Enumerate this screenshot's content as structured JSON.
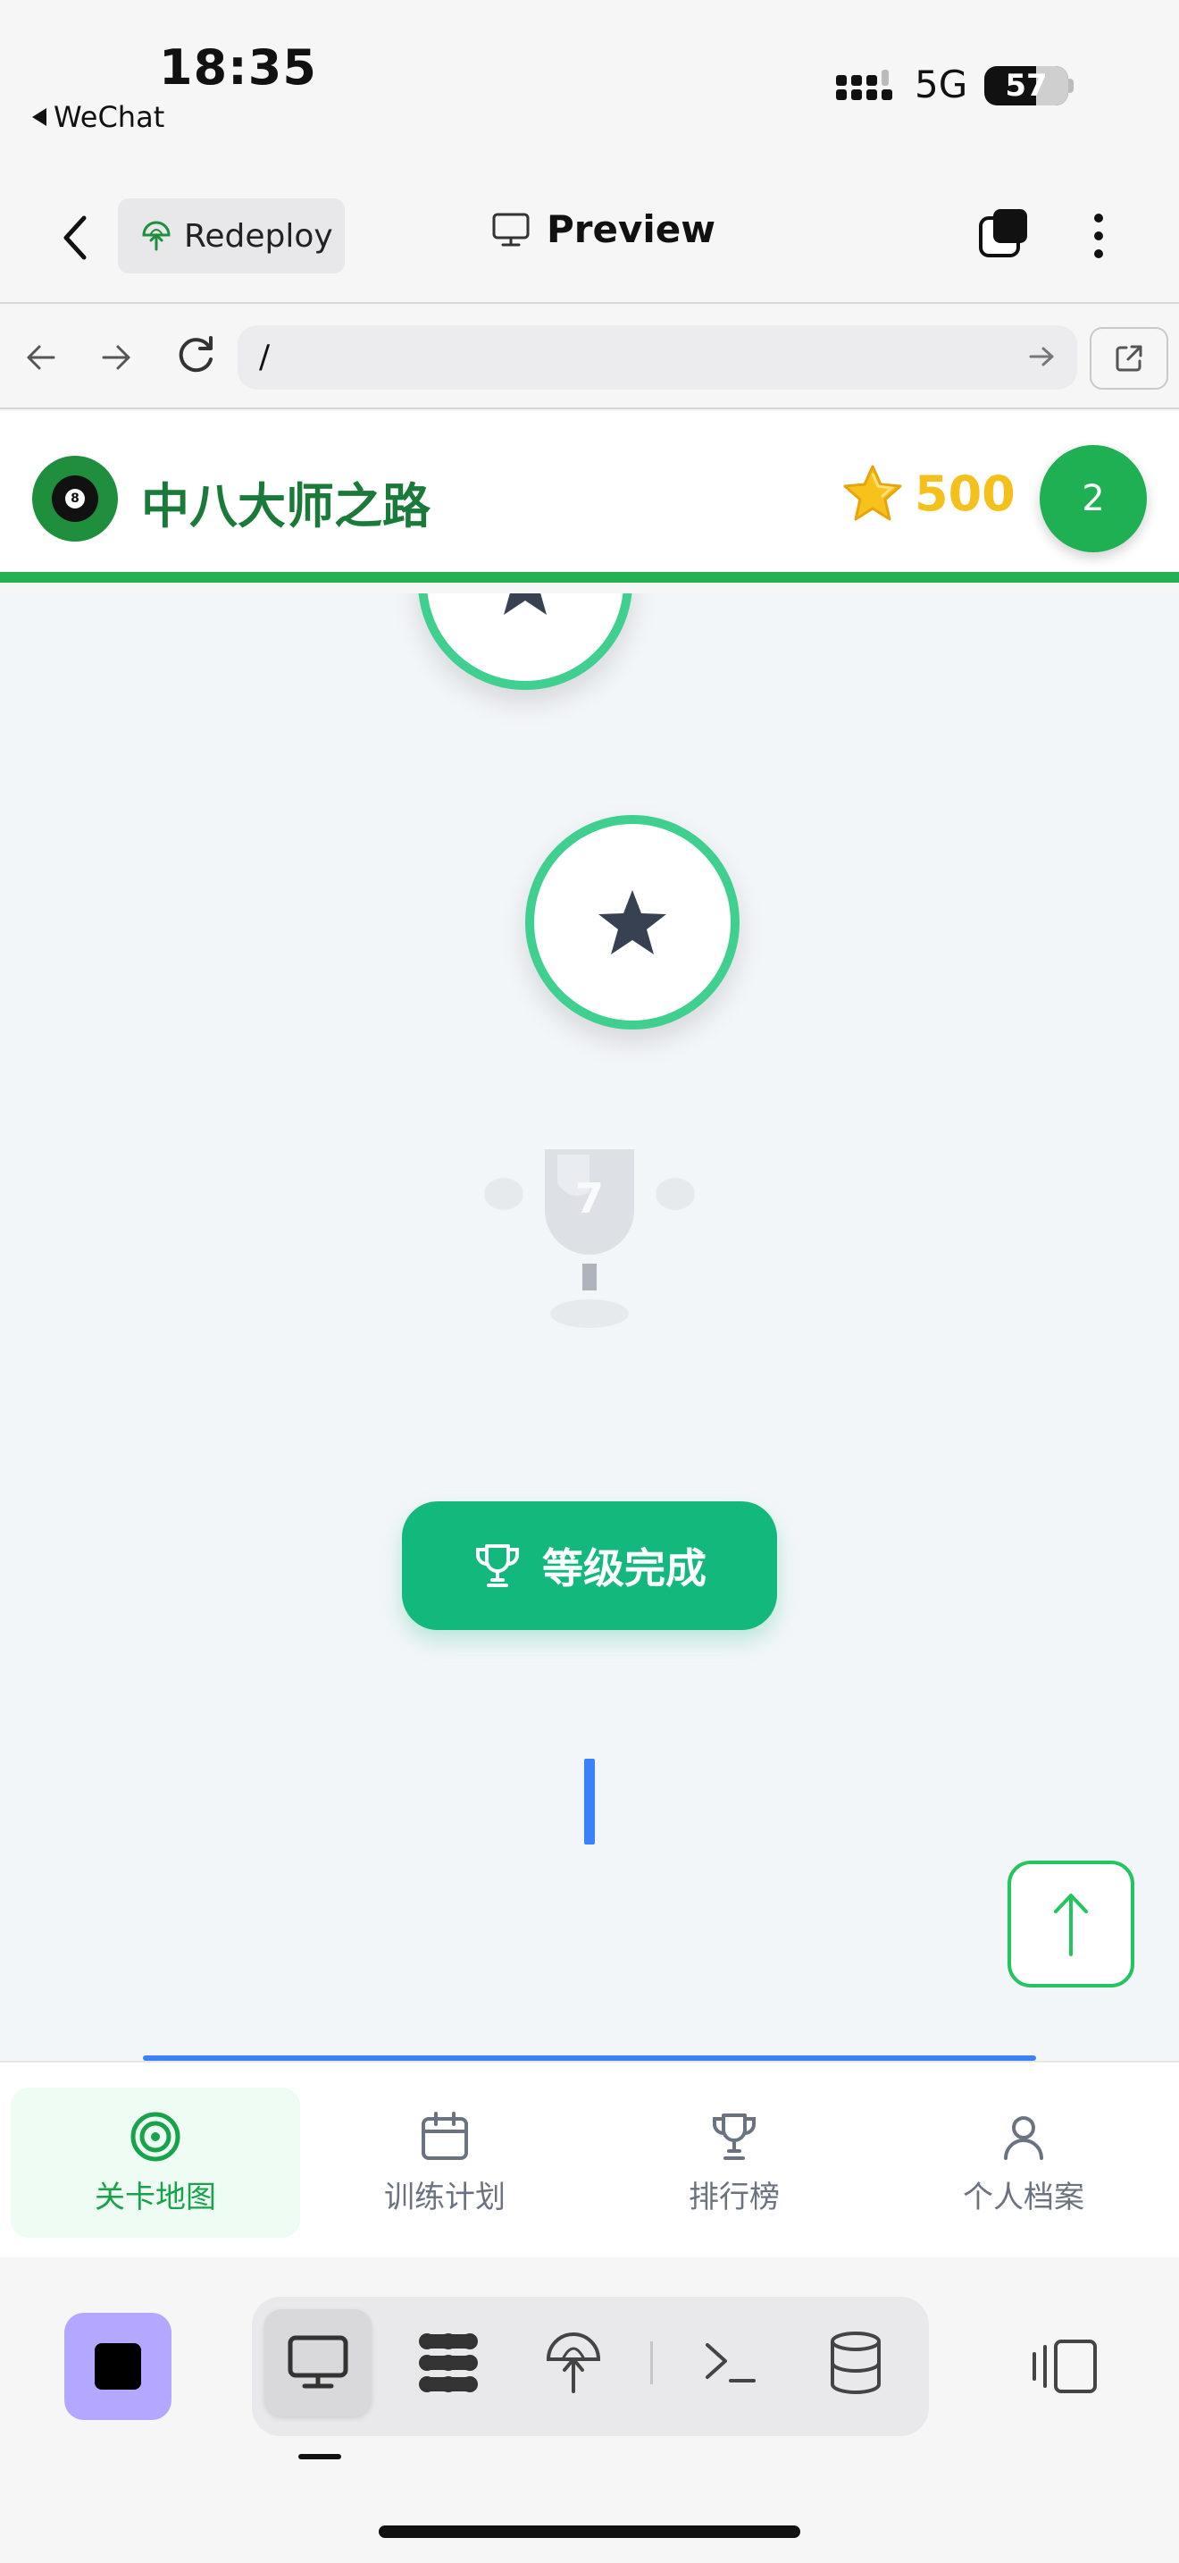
{
  "status_bar": {
    "time": "18:35",
    "back_app": "WeChat",
    "network": "5G",
    "battery": "57"
  },
  "toolbar": {
    "redeploy_label": "Redeploy",
    "preview_label": "Preview"
  },
  "address_bar": {
    "url": "/"
  },
  "app_header": {
    "title": "中八大师之路",
    "score": "500",
    "level": "2"
  },
  "map": {
    "trophy_level": "7",
    "complete_label": "等级完成"
  },
  "tabs": [
    {
      "label": "关卡地图",
      "icon": "target-icon",
      "active": true
    },
    {
      "label": "训练计划",
      "icon": "calendar-icon",
      "active": false
    },
    {
      "label": "排行榜",
      "icon": "trophy-icon",
      "active": false
    },
    {
      "label": "个人档案",
      "icon": "user-icon",
      "active": false
    }
  ],
  "colors": {
    "brand_green": "#22b050",
    "node_ring": "#3fcf8e",
    "score_gold": "#f3c01c",
    "button_green": "#12b87c",
    "stop_purple": "#b4a7ff"
  }
}
